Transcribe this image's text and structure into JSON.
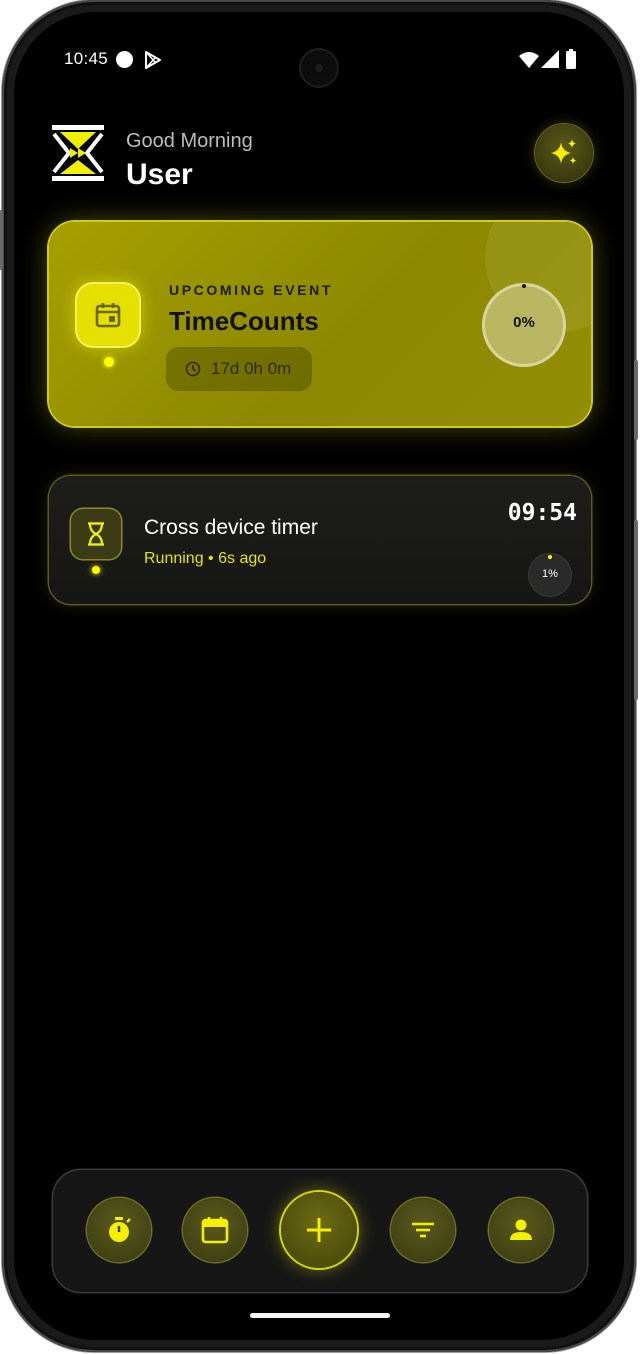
{
  "status_bar": {
    "time": "10:45"
  },
  "header": {
    "greeting": "Good Morning",
    "username": "User"
  },
  "event_card": {
    "label": "UPCOMING EVENT",
    "title": "TimeCounts",
    "countdown": "17d 0h 0m",
    "progress_text": "0%",
    "progress": 0
  },
  "timer_card": {
    "title": "Cross device timer",
    "status": "Running • 6s ago",
    "time": "09:54",
    "progress_text": "1%",
    "progress": 1
  },
  "nav": {
    "items": [
      "stopwatch-icon",
      "calendar-icon",
      "add-icon",
      "filter-icon",
      "profile-icon"
    ]
  },
  "colors": {
    "accent": "#ffff00",
    "card_yellow": "#a6a000",
    "background": "#000000"
  }
}
